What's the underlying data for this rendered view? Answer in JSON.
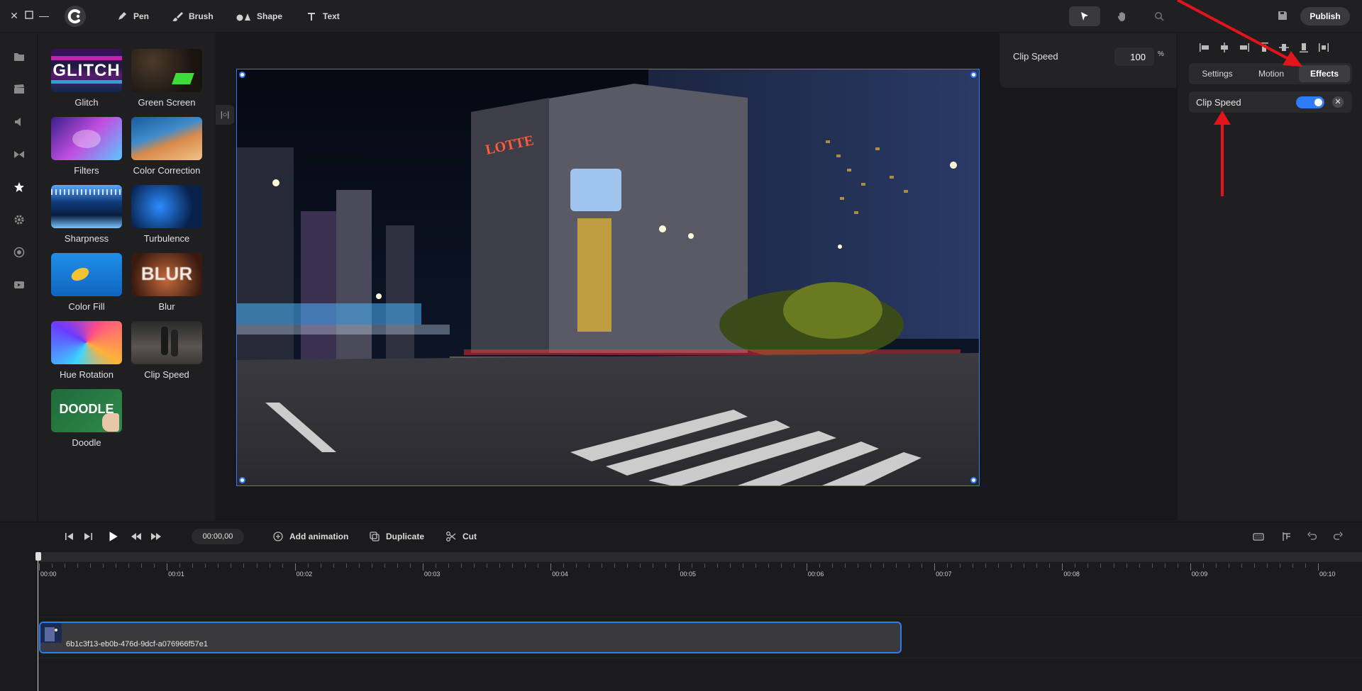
{
  "toolbar": {
    "tools": [
      {
        "label": "Pen",
        "icon": "pen-icon"
      },
      {
        "label": "Brush",
        "icon": "brush-icon"
      },
      {
        "label": "Shape",
        "icon": "shape-icon"
      },
      {
        "label": "Text",
        "icon": "text-icon"
      }
    ],
    "publish_label": "Publish"
  },
  "effects": [
    {
      "label": "Glitch",
      "thumb_text": "GLITCH"
    },
    {
      "label": "Green Screen"
    },
    {
      "label": "Filters"
    },
    {
      "label": "Color Correction"
    },
    {
      "label": "Sharpness"
    },
    {
      "label": "Turbulence"
    },
    {
      "label": "Color Fill"
    },
    {
      "label": "Blur",
      "thumb_text": "BLUR"
    },
    {
      "label": "Hue Rotation"
    },
    {
      "label": "Clip Speed"
    },
    {
      "label": "Doodle",
      "thumb_text": "DOODLE"
    }
  ],
  "speed_panel": {
    "label": "Clip Speed",
    "value": "100",
    "unit": "%"
  },
  "right_panel": {
    "tabs": [
      {
        "label": "Settings",
        "active": false
      },
      {
        "label": "Motion",
        "active": false
      },
      {
        "label": "Effects",
        "active": true
      }
    ],
    "applied_effect": {
      "name": "Clip Speed",
      "enabled": true
    }
  },
  "timeline": {
    "add_animation_label": "Add animation",
    "duplicate_label": "Duplicate",
    "cut_label": "Cut",
    "current_time": "00:00,00",
    "ruler_labels": [
      "00:00",
      "00:01",
      "00:02",
      "00:03",
      "00:04",
      "00:05",
      "00:06",
      "00:07",
      "00:08",
      "00:09",
      "00:10"
    ],
    "clip_name": "6b1c3f13-eb0b-476d-9dcf-a076966f57e1"
  },
  "colors": {
    "accent": "#2f7bf5",
    "annotation": "#e3141b"
  }
}
